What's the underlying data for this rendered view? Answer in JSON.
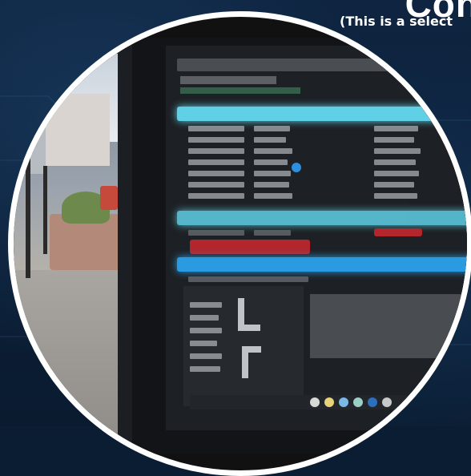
{
  "header": {
    "title": "Con",
    "subtitle": "(This is a select"
  },
  "photo": {
    "subject": "monitor-with-spreadsheet-and-street-view"
  },
  "colors": {
    "background": "#0b1d33",
    "frame_border": "#ffffff",
    "highlight_cyan": "#5fd0e6",
    "highlight_blue": "#2a9be0",
    "highlight_red": "#b3262b"
  }
}
